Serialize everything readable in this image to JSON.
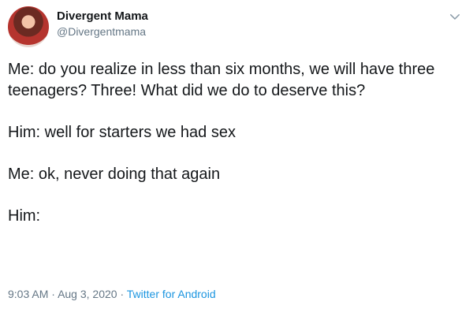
{
  "author": {
    "display_name": "Divergent Mama",
    "handle": "@Divergentmama"
  },
  "tweet": {
    "lines": [
      "Me: do you realize in less than six months, we will have three teenagers? Three! What did we do to deserve this?",
      "Him: well for starters we had sex",
      "Me: ok, never doing that again",
      "Him:"
    ],
    "time": "9:03 AM",
    "separator": "·",
    "date": "Aug 3, 2020",
    "source": "Twitter for Android"
  },
  "icons": {
    "menu": "chevron-down-icon"
  },
  "colors": {
    "text": "#14171a",
    "muted": "#657786",
    "link": "#1b95e0"
  }
}
